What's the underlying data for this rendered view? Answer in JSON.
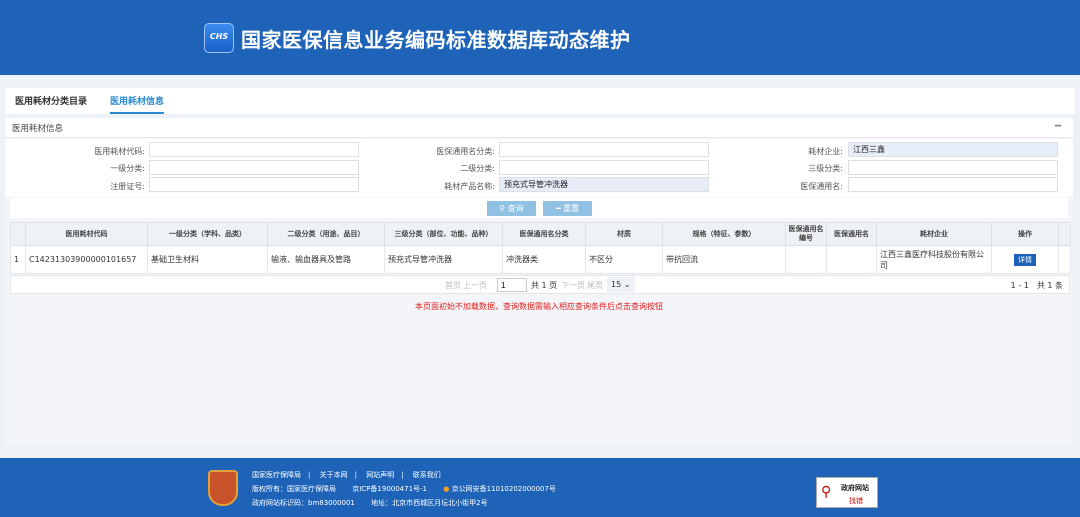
{
  "header": {
    "logo_text": "CHS",
    "title": "国家医保信息业务编码标准数据库动态维护"
  },
  "tabs": [
    {
      "label": "医用耗材分类目录",
      "active": false
    },
    {
      "label": "医用耗材信息",
      "active": true
    }
  ],
  "panel": {
    "title": "医用耗材信息",
    "collapse_icon": "minus-icon"
  },
  "form": {
    "code": {
      "label": "医用耗材代码:",
      "value": ""
    },
    "yb_category": {
      "label": "医保通用名分类:",
      "value": ""
    },
    "company": {
      "label": "耗材企业:",
      "value": "江西三鑫"
    },
    "level1": {
      "label": "一级分类:",
      "value": ""
    },
    "level2": {
      "label": "二级分类:",
      "value": ""
    },
    "level3": {
      "label": "三级分类:",
      "value": ""
    },
    "reg_no": {
      "label": "注册证号:",
      "value": ""
    },
    "product_name": {
      "label": "耗材产品名称:",
      "value": "预充式导管冲洗器"
    },
    "yb_name": {
      "label": "医保通用名:",
      "value": ""
    }
  },
  "buttons": {
    "query": "查询",
    "reset": "重置"
  },
  "table": {
    "headers": [
      "",
      "医用耗材代码",
      "一级分类（学科、品类）",
      "二级分类（用途、品目）",
      "三级分类（部位、功能、品种）",
      "医保通用名分类",
      "材质",
      "规格（特征、参数）",
      "医保通用名编号",
      "医保通用名",
      "耗材企业",
      "操作"
    ],
    "rows": [
      [
        "1",
        "C14231303900000101657",
        "基础卫生材料",
        "输液、输血器具及管路",
        "预充式导管冲洗器",
        "冲洗器类",
        "不区分",
        "带抗回流",
        "",
        "",
        "江西三鑫医疗科技股份有限公司",
        "详情"
      ]
    ]
  },
  "pager": {
    "first": "首页",
    "prev": "上一页",
    "page": "1",
    "total_pages": "共 1 页",
    "next": "下一页",
    "last": "尾页",
    "page_size": "15",
    "summary": "1 - 1　共 1 条"
  },
  "note": "本页面初始不加载数据，查询数据需输入相应查询条件后点击查询按钮",
  "footer": {
    "links": [
      "国家医疗保障局",
      "关于本网",
      "网站声明",
      "联系我们"
    ],
    "copyright": "版权所有：国家医疗保障局",
    "icp": "京ICP备19000471号-1",
    "police": "京公网安备11010202000007号",
    "site_id": "政府网站标识码：bm83000001",
    "address": "地址：北京市西城区月坛北小街甲2号",
    "gov_badge": {
      "line1": "政府网站",
      "line2": "找错"
    }
  }
}
